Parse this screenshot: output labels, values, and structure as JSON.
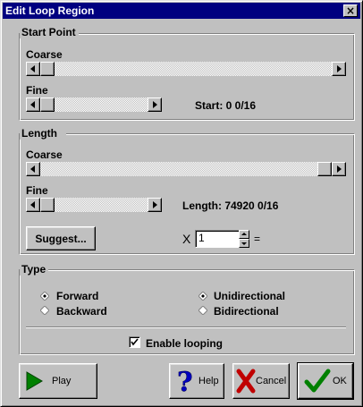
{
  "window": {
    "title": "Edit Loop Region",
    "close_glyph": "×"
  },
  "start_point": {
    "title": "Start Point",
    "coarse_label": "Coarse",
    "fine_label": "Fine",
    "start_readout": "Start:  0 0/16"
  },
  "length": {
    "title": "Length",
    "coarse_label": "Coarse",
    "fine_label": "Fine",
    "length_readout": "Length:  74920 0/16",
    "suggest_label": "Suggest...",
    "multiplier_prefix": "X",
    "multiplier_value": "1",
    "multiplier_suffix": "="
  },
  "type": {
    "title": "Type",
    "direction_options": [
      "Forward",
      "Backward"
    ],
    "direction_selected": "Forward",
    "mode_options": [
      "Unidirectional",
      "Bidirectional"
    ],
    "mode_selected": "Unidirectional",
    "enable_looping_label": "Enable looping",
    "enable_looping_checked": true
  },
  "buttons": {
    "play": "Play",
    "help": "Help",
    "cancel": "Cancel",
    "ok": "OK"
  },
  "icons": {
    "play": "play-icon",
    "help": "question-mark-icon",
    "cancel": "x-icon",
    "ok": "checkmark-icon"
  },
  "colors": {
    "titlebar": "#000080",
    "play_icon": "#008000",
    "help_icon": "#0000c0",
    "cancel_icon": "#c00000",
    "ok_icon": "#008000"
  }
}
